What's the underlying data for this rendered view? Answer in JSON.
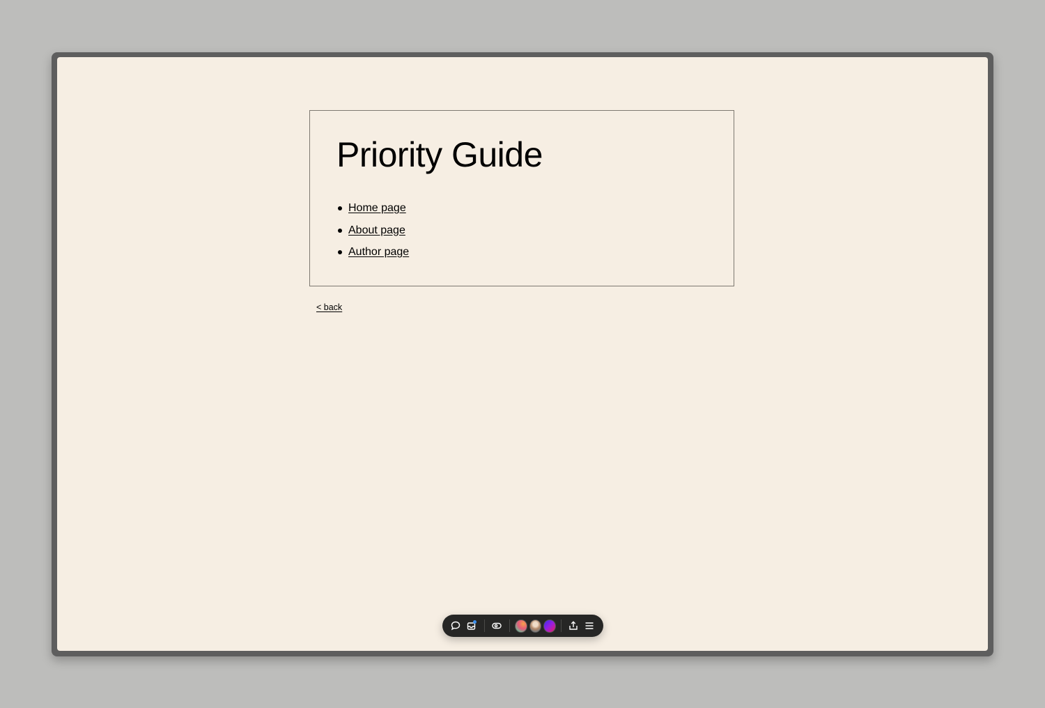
{
  "page": {
    "title": "Priority Guide",
    "links": [
      {
        "label": "Home page"
      },
      {
        "label": "About page"
      },
      {
        "label": "Author page"
      }
    ],
    "back_label": "< back"
  },
  "toolbar": {
    "icons": [
      "comment-icon",
      "inbox-icon",
      "preview-icon",
      "share-icon",
      "menu-icon"
    ],
    "avatars": [
      "user-avatar-gradient-green",
      "user-avatar-photo",
      "user-avatar-gradient-purple"
    ],
    "notification_color": "#3b8eea"
  }
}
